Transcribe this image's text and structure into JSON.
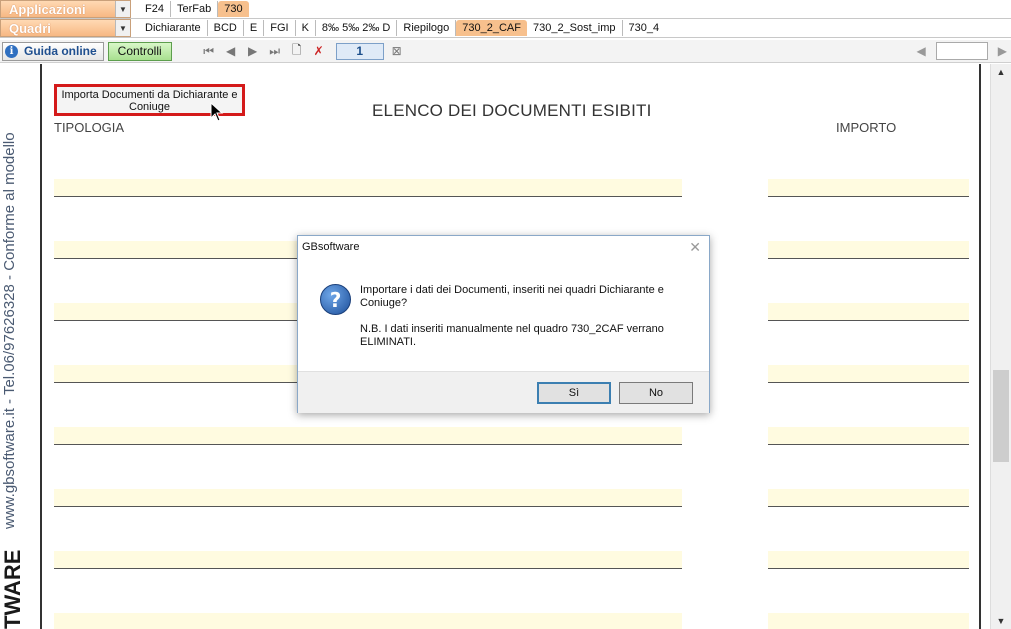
{
  "menu": {
    "applicazioni_label": "Applicazioni",
    "quadri_label": "Quadri",
    "app_tabs": [
      {
        "label": "F24",
        "active": false
      },
      {
        "label": "TerFab",
        "active": false
      },
      {
        "label": "730",
        "active": true
      }
    ],
    "quadri_tabs": [
      {
        "label": "Dichiarante",
        "active": false
      },
      {
        "label": "BCD",
        "active": false
      },
      {
        "label": "E",
        "active": false
      },
      {
        "label": "FGI",
        "active": false
      },
      {
        "label": "K",
        "active": false
      },
      {
        "label": "8‰ 5‰ 2‰ D",
        "active": false
      },
      {
        "label": "Riepilogo",
        "active": false
      },
      {
        "label": "730_2_CAF",
        "active": true
      },
      {
        "label": "730_2_Sost_imp",
        "active": false
      },
      {
        "label": "730_4",
        "active": false
      }
    ]
  },
  "toolbar": {
    "guida_label": "Guida online",
    "controlli_label": "Controlli",
    "page_number": "1",
    "search_value": ""
  },
  "banner": {
    "vertical_text": "www.gbsoftware.it - Tel.06/97626328 - Conforme al modello",
    "vertical_bold": "TWARE"
  },
  "document": {
    "import_button_label": "Importa Documenti da Dichiarante e Coniuge",
    "title": "ELENCO DEI DOCUMENTI ESIBITI",
    "col_tipologia": "TIPOLOGIA",
    "col_importo": "IMPORTO",
    "row_count": 8
  },
  "dialog": {
    "title": "GBsoftware",
    "message": "Importare i dati dei Documenti, inseriti nei quadri Dichiarante e Coniuge?",
    "note": "N.B. I dati inseriti manualmente nel quadro 730_2CAF verrano ELIMINATI.",
    "yes_label": "Sì",
    "no_label": "No"
  },
  "colors": {
    "accent_orange": "#f7b883",
    "highlight_red": "#d41a1a",
    "row_fill": "#fffbe0",
    "info_blue": "#2f6fc0"
  }
}
